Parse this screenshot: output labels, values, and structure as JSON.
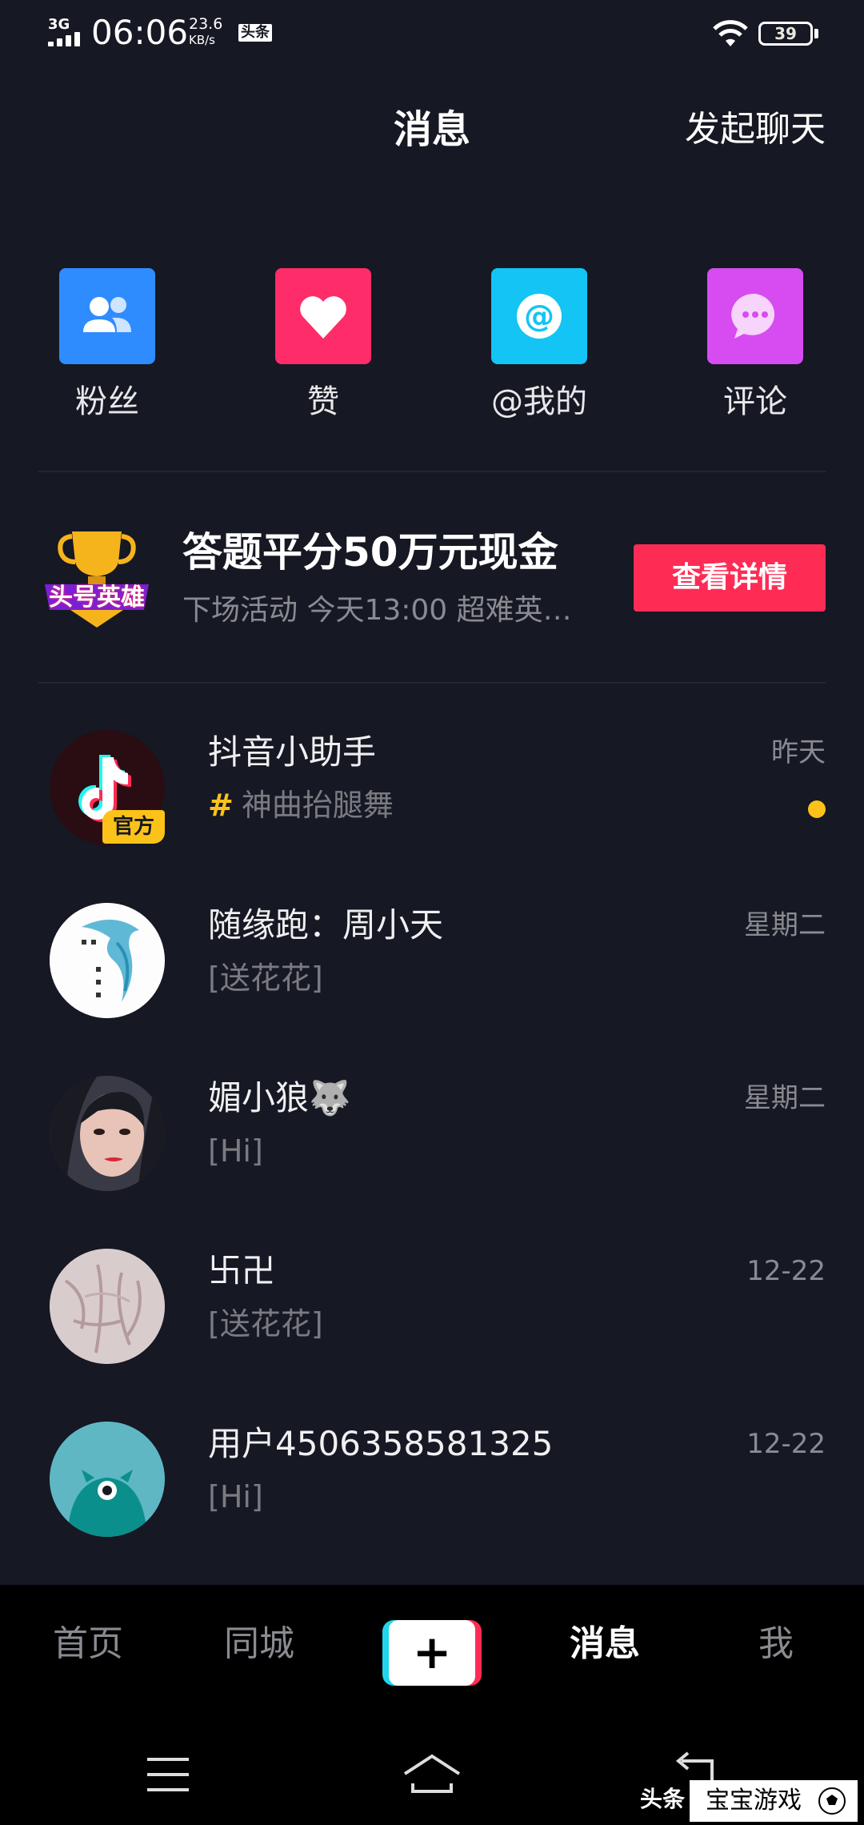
{
  "status_bar": {
    "network": "3G",
    "time": "06:06",
    "speed_value": "23.6",
    "speed_unit": "KB/s",
    "app_badge": "头条",
    "battery": "39"
  },
  "header": {
    "title": "消息",
    "start_chat": "发起聊天"
  },
  "categories": [
    {
      "label": "粉丝",
      "icon": "fans-icon",
      "color": "#2f8cff"
    },
    {
      "label": "赞",
      "icon": "heart-icon",
      "color": "#fe2c68"
    },
    {
      "label": "@我的",
      "icon": "at-icon",
      "color": "#14c4f5"
    },
    {
      "label": "评论",
      "icon": "comment-icon",
      "color": "#d64cf0"
    }
  ],
  "promo": {
    "logo_text": "头号英雄",
    "title": "答题平分50万元现金",
    "subtitle": "下场活动 今天13:00 超难英…",
    "button": "查看详情"
  },
  "messages": [
    {
      "name": "抖音小助手",
      "preview": "神曲抬腿舞",
      "time": "昨天",
      "hashtag": "#",
      "badge": "官方",
      "unread": true
    },
    {
      "name": "随缘跑：周小天",
      "preview": "[送花花]",
      "time": "星期二"
    },
    {
      "name": "媚小狼🐺",
      "preview": "[Hi]",
      "time": "星期二"
    },
    {
      "name": "卐卍",
      "preview": "[送花花]",
      "time": "12-22"
    },
    {
      "name": "用户4506358581325",
      "preview": "[Hi]",
      "time": "12-22"
    }
  ],
  "bottom_nav": {
    "items": [
      "首页",
      "同城",
      "+",
      "消息",
      "我"
    ],
    "active": "消息"
  },
  "watermark": {
    "left": "头条",
    "right": "宝宝游戏"
  }
}
